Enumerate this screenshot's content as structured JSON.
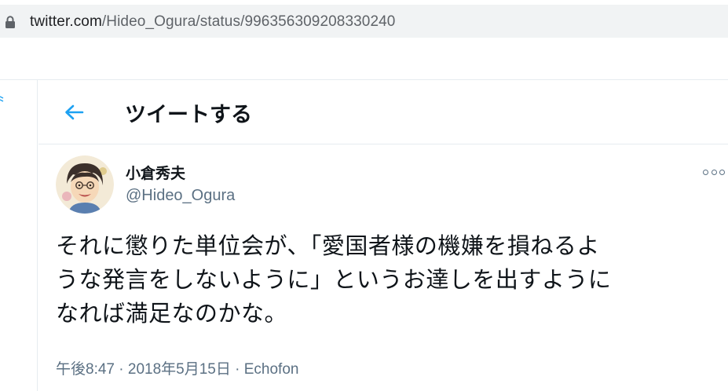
{
  "browser": {
    "url_host": "twitter.com",
    "url_path": "/Hideo_Ogura/status/996356309208330240"
  },
  "header": {
    "back_icon": "arrow-left-icon",
    "title": "ツイートする"
  },
  "tweet": {
    "display_name": "小倉秀夫",
    "username": "@Hideo_Ogura",
    "text_lines": [
      "それに懲りた単位会が、「愛国者様の機嫌を損ねるよ",
      "うな発言をしないように」というお達しを出すように",
      "なれば満足なのかな。"
    ],
    "time": "午後8:47",
    "separator": " · ",
    "date": "2018年5月15日",
    "source": "Echofon",
    "more_icon": "more-horizontal-icon"
  },
  "colors": {
    "accent": "#1da1f2",
    "text": "#0f1419",
    "secondary": "#5b7083",
    "border": "#e6ecf0"
  }
}
